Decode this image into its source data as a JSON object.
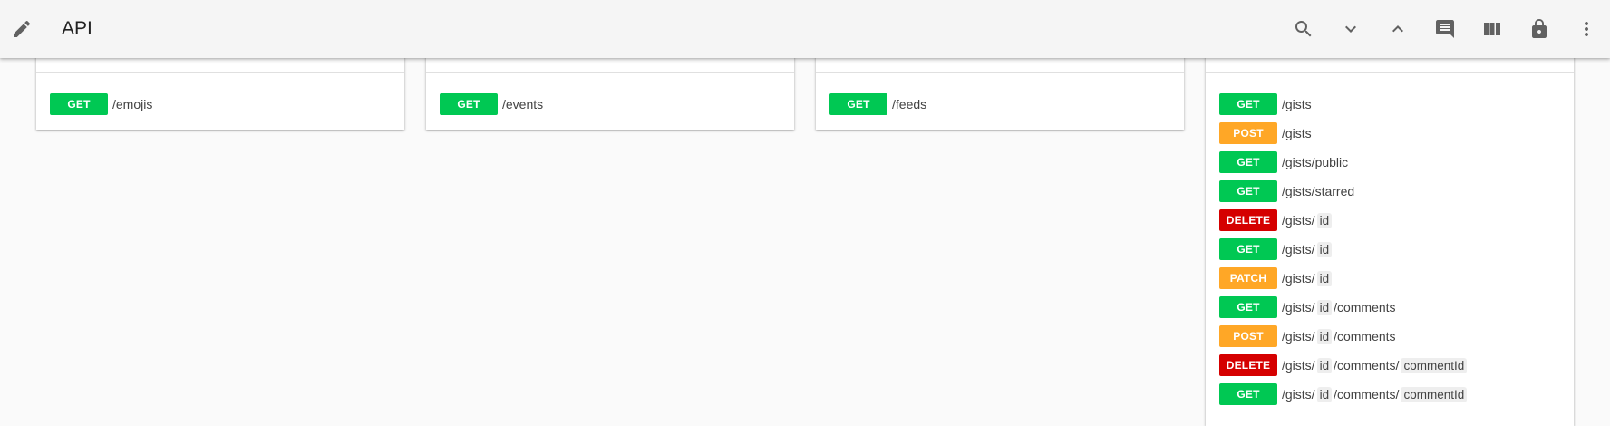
{
  "appbar": {
    "title": "API",
    "icons": [
      "edit-icon",
      "search-icon",
      "chevron-down-icon",
      "chevron-up-icon",
      "comment-icon",
      "columns-icon",
      "lock-icon",
      "more-vert-icon"
    ]
  },
  "colors": {
    "get": "#00c853",
    "post": "#ffa726",
    "patch": "#ffa726",
    "delete": "#d50000"
  },
  "cards": {
    "emojis": {
      "endpoints": [
        {
          "method": "GET",
          "path": "/emojis"
        }
      ]
    },
    "events": {
      "endpoints": [
        {
          "method": "GET",
          "path": "/events"
        }
      ]
    },
    "feeds": {
      "endpoints": [
        {
          "method": "GET",
          "path": "/feeds"
        }
      ]
    },
    "gists": {
      "endpoints": [
        {
          "method": "GET",
          "path": "/gists"
        },
        {
          "method": "POST",
          "path": "/gists"
        },
        {
          "method": "GET",
          "path": "/gists/public"
        },
        {
          "method": "GET",
          "path": "/gists/starred"
        },
        {
          "method": "DELETE",
          "seg1": "/gists/",
          "param1": "id"
        },
        {
          "method": "GET",
          "seg1": "/gists/",
          "param1": "id"
        },
        {
          "method": "PATCH",
          "seg1": "/gists/",
          "param1": "id"
        },
        {
          "method": "GET",
          "seg1": "/gists/",
          "param1": "id",
          "seg2": "/comments"
        },
        {
          "method": "POST",
          "seg1": "/gists/",
          "param1": "id",
          "seg2": "/comments"
        },
        {
          "method": "DELETE",
          "seg1": "/gists/",
          "param1": "id",
          "seg2": "/comments/",
          "param2": "commentId"
        },
        {
          "method": "GET",
          "seg1": "/gists/",
          "param1": "id",
          "seg2": "/comments/",
          "param2": "commentId"
        }
      ]
    }
  }
}
